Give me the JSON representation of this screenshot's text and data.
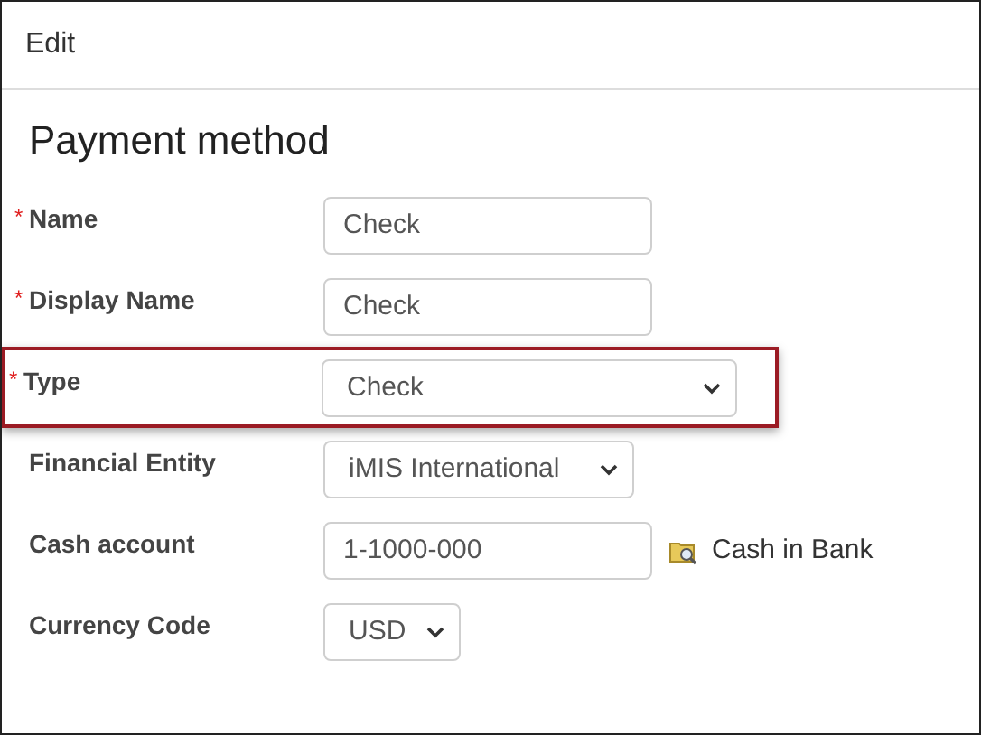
{
  "header": {
    "title": "Edit"
  },
  "form": {
    "title": "Payment method",
    "fields": [
      {
        "label": "Name",
        "marker": "*",
        "kind": "text",
        "value": "Check",
        "highlighted": false
      },
      {
        "label": "Display Name",
        "marker": "*",
        "kind": "text",
        "value": "Check",
        "highlighted": false
      },
      {
        "label": "Type",
        "marker": "*",
        "kind": "select",
        "value": "Check",
        "highlighted": true
      },
      {
        "label": "Financial Entity",
        "kind": "select",
        "value": "iMIS International",
        "highlighted": false
      },
      {
        "label": "Cash account",
        "kind": "lookup",
        "value": "1-1000-000",
        "description": "Cash in Bank",
        "highlighted": false
      },
      {
        "label": "Currency Code",
        "kind": "select",
        "value": "USD",
        "highlighted": false
      }
    ]
  }
}
